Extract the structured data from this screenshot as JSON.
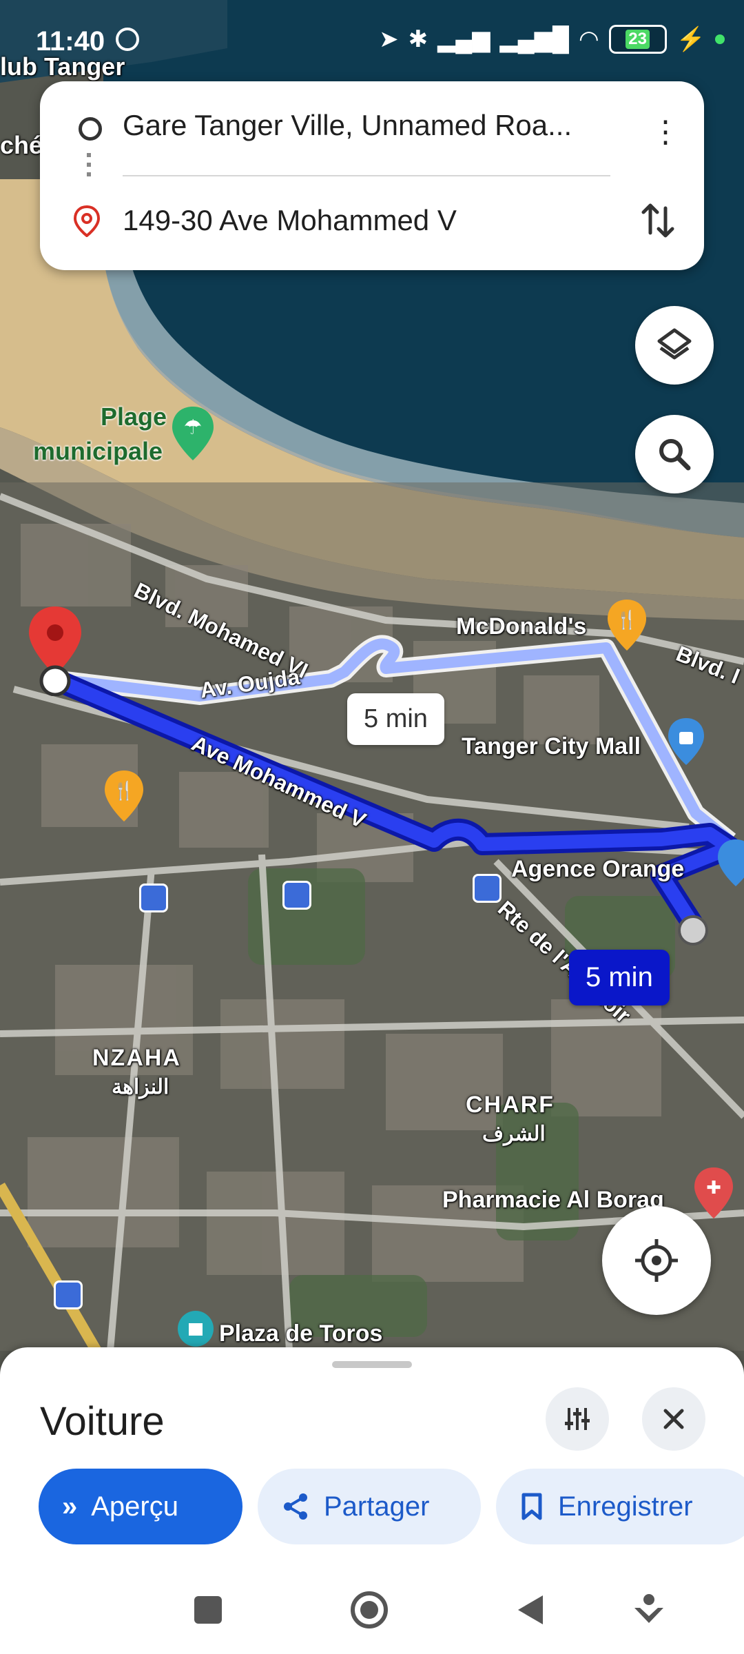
{
  "status_bar": {
    "time": "11:40",
    "battery": "23"
  },
  "route": {
    "origin": "Gare Tanger Ville, Unnamed Roa...",
    "destination": "149-30 Ave Mohammed V",
    "menu_icon": "more-vert-icon",
    "swap_icon": "swap-vertical-icon"
  },
  "map": {
    "labels": {
      "club_tanger": "lub Tanger",
      "che": "ché",
      "plage_line1": "Plage",
      "plage_line2": "municipale",
      "blvd_mohamed_vi": "Blvd. Mohamed VI",
      "blvd_right": "Blvd. I",
      "mcdonalds": "McDonald's",
      "av_oujda": "Av. Oujda",
      "ave_mohammed_v": "Ave Mohammed V",
      "tanger_city_mall": "Tanger City Mall",
      "agence_orange": "Agence Orange",
      "rte_abattoir": "Rte de l'Abattoir",
      "nzaha": "NZAHA",
      "nzaha_ar": "النزاهة",
      "charf": "CHARF",
      "charf_ar": "الشرف",
      "pharmacie": "Pharmacie Al Boraq",
      "plaza_toros": "Plaza de Toros"
    },
    "time_alt": "5 min",
    "time_main": "5 min",
    "colors": {
      "route_main": "#1a2fe0",
      "route_alt": "#9fb4ff",
      "sea": "#0b3a52",
      "beach": "#d8bf8e"
    }
  },
  "sheet": {
    "mode_title": "Voiture",
    "options_icon": "tune-icon",
    "close_icon": "close-icon",
    "buttons": {
      "preview": "Aperçu",
      "share": "Partager",
      "save": "Enregistrer"
    }
  },
  "nav": {
    "recents_icon": "square-icon",
    "home_icon": "circle-icon",
    "back_icon": "back-triangle-icon",
    "assistant_icon": "assistant-icon"
  }
}
